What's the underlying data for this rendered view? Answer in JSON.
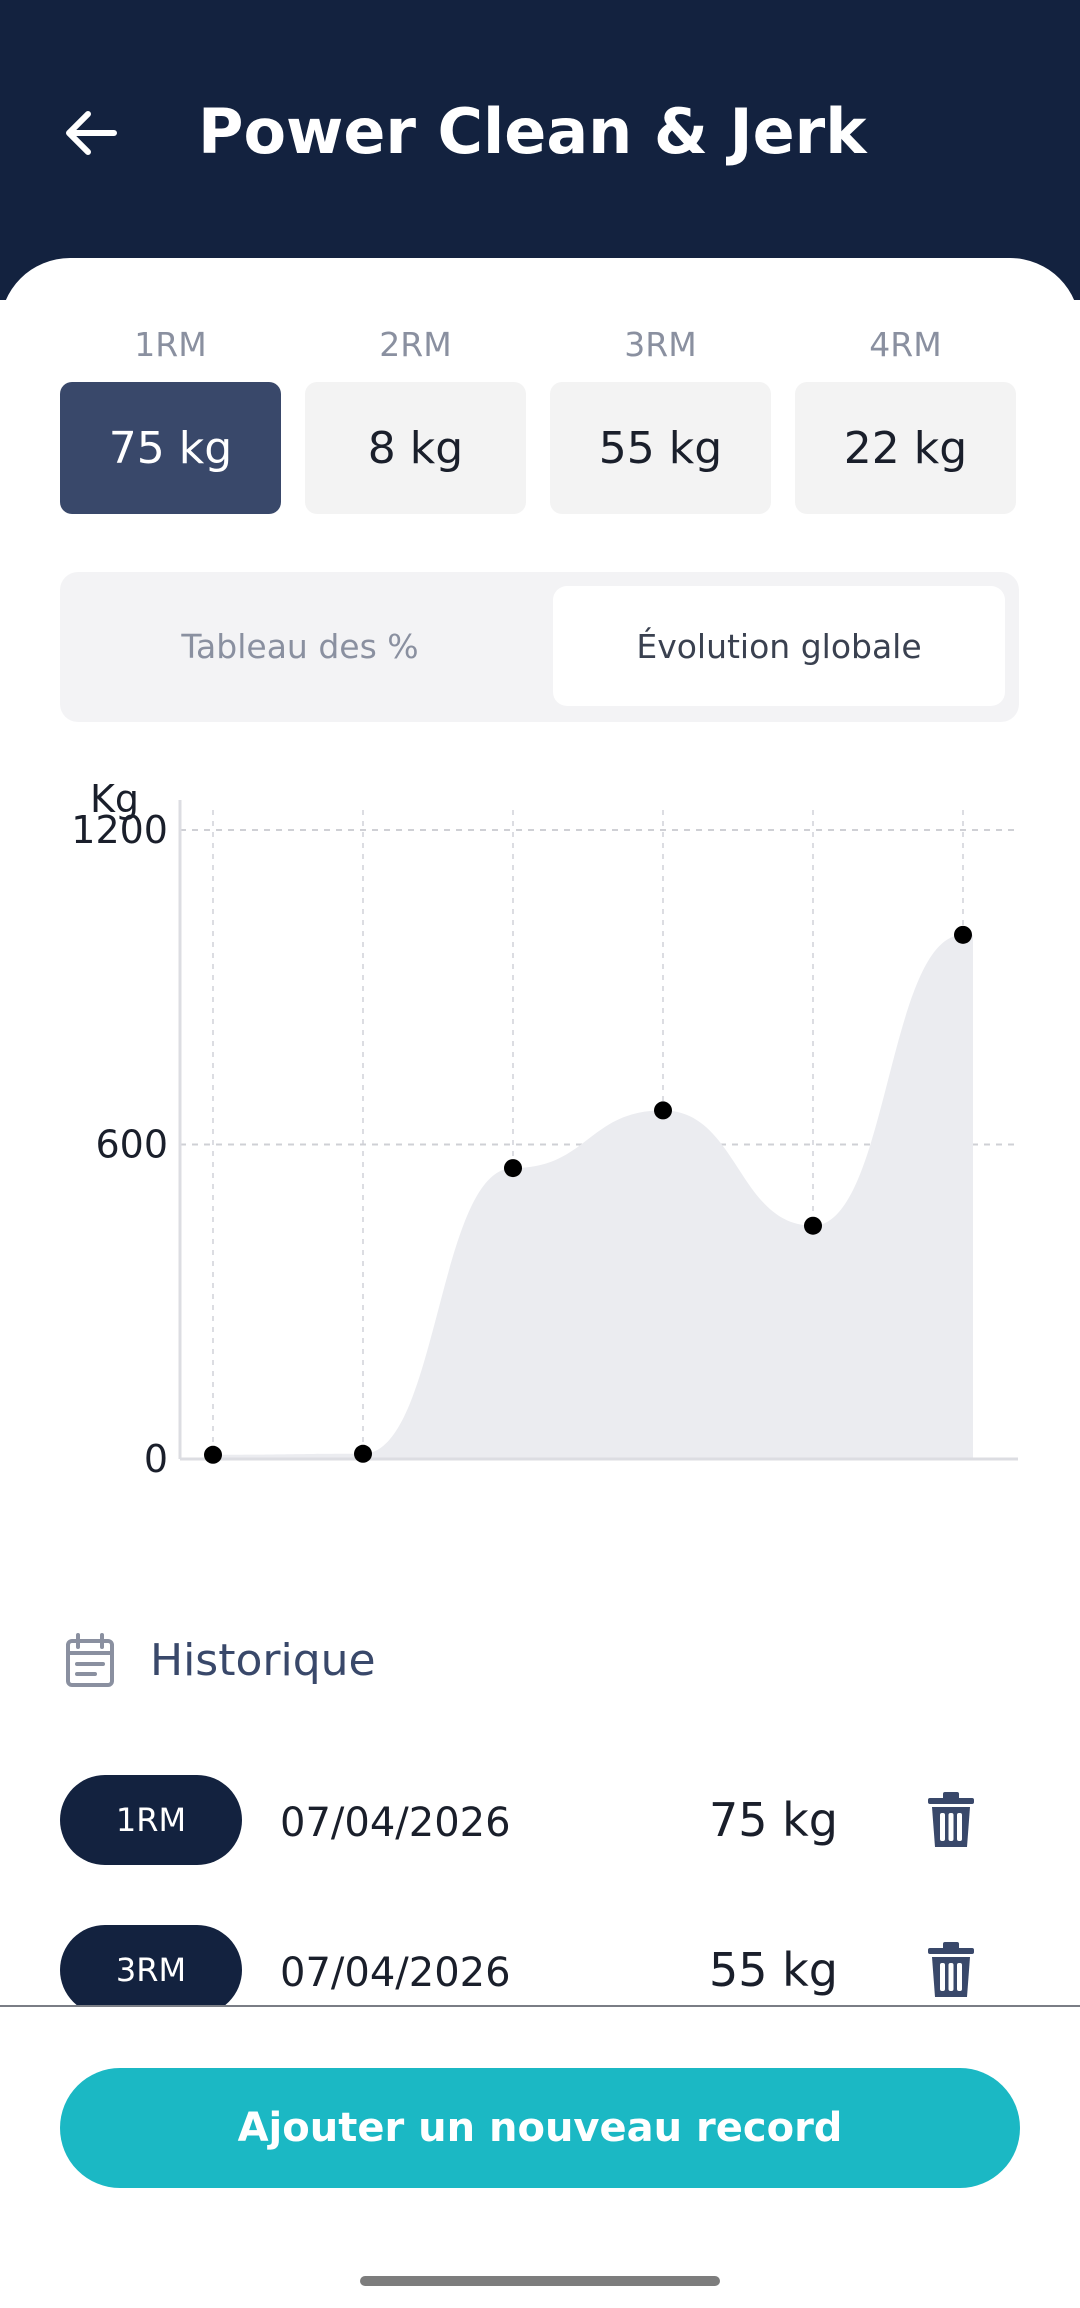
{
  "header": {
    "title": "Power Clean & Jerk"
  },
  "rm_stats": [
    {
      "label": "1RM",
      "value": "75 kg",
      "active": true
    },
    {
      "label": "2RM",
      "value": "8 kg",
      "active": false
    },
    {
      "label": "3RM",
      "value": "55 kg",
      "active": false
    },
    {
      "label": "4RM",
      "value": "22 kg",
      "active": false
    }
  ],
  "tabs": [
    {
      "label": "Tableau des %",
      "active": false
    },
    {
      "label": "Évolution globale",
      "active": true
    }
  ],
  "chart_data": {
    "type": "area",
    "ylabel": "Kg",
    "ylim": [
      0,
      1200
    ],
    "yticks": [
      "0",
      "600",
      "1200"
    ],
    "x": [
      1,
      2,
      3,
      4,
      5,
      6
    ],
    "values": [
      8,
      10,
      555,
      665,
      445,
      1000
    ],
    "grid": true,
    "fill_color": "#ebecf0",
    "point_color": "#000000"
  },
  "history": {
    "title": "Historique",
    "items": [
      {
        "tag": "1RM",
        "date": "07/04/2026",
        "value": "75 kg"
      },
      {
        "tag": "3RM",
        "date": "07/04/2026",
        "value": "55 kg"
      }
    ]
  },
  "add_button": {
    "label": "Ajouter un nouveau record"
  },
  "colors": {
    "header_bg": "#13223f",
    "active_rm": "#39486a",
    "accent": "#1bb8c4"
  }
}
